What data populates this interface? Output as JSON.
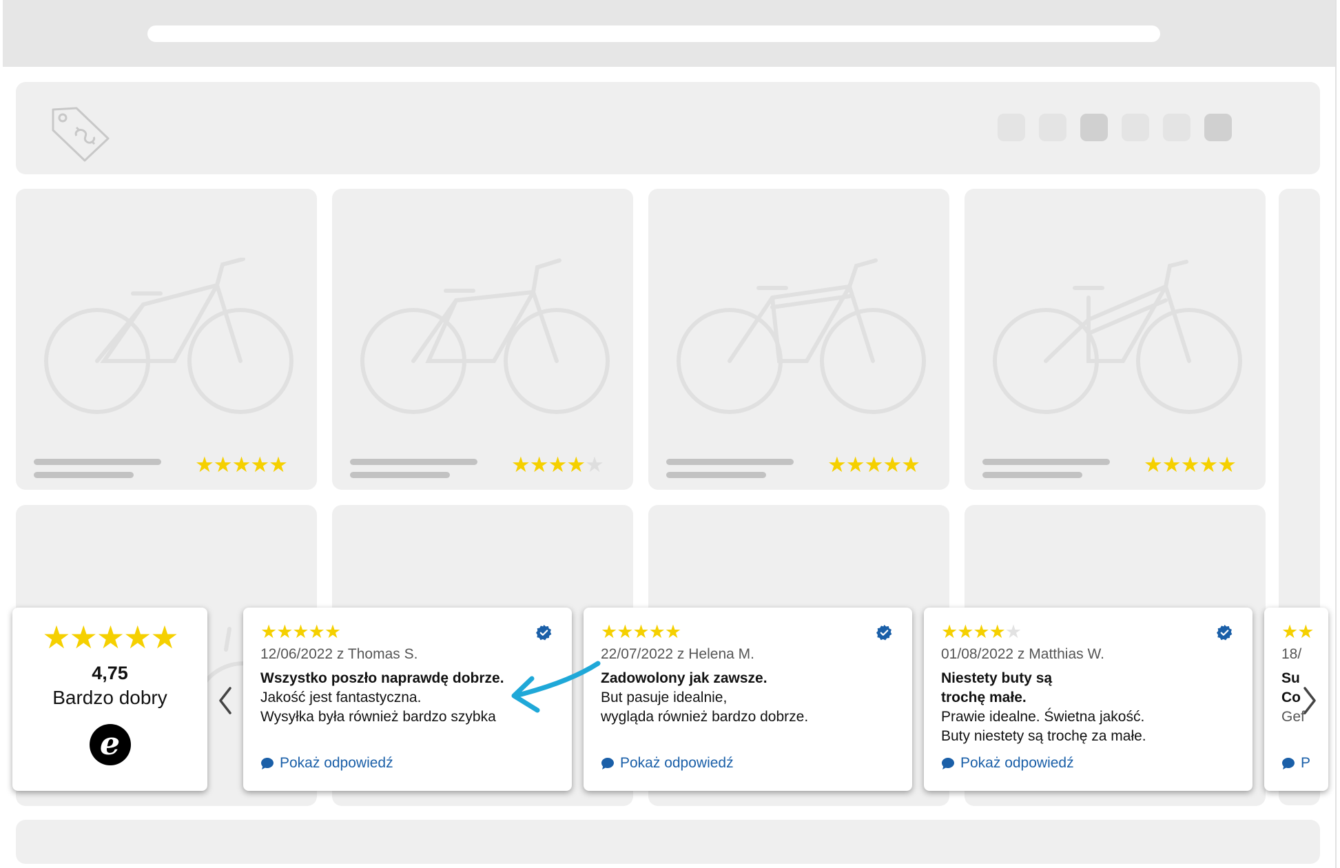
{
  "colors": {
    "star": "#f5d000",
    "link": "#1a5fa8",
    "verified": "#1a5fa8",
    "annotation": "#1fa8d8"
  },
  "icons": {
    "header": "price-tag-icon",
    "product": "bicycle-icon",
    "verified": "verified-badge-icon",
    "reply": "chat-bubble-icon",
    "prev": "chevron-left-icon",
    "next": "chevron-right-icon"
  },
  "products_row1": [
    {
      "rating": 5
    },
    {
      "rating": 4
    },
    {
      "rating": 5
    },
    {
      "rating": 5
    }
  ],
  "summary": {
    "stars": "★★★★★",
    "score": "4,75",
    "label": "Bardzo dobry",
    "logo": "e"
  },
  "reviews": [
    {
      "stars": "★★★★★",
      "meta": "12/06/2022 z Thomas S.",
      "title_lines": [
        "Wszystko poszło naprawdę dobrze."
      ],
      "body_lines": [
        "Jakość jest fantastyczna.",
        "Wysyłka była również bardzo szybka"
      ],
      "reply": "Pokaż odpowiedź"
    },
    {
      "stars": "★★★★★",
      "meta": "22/07/2022 z Helena M.",
      "title_lines": [
        "Zadowolony jak zawsze."
      ],
      "body_lines": [
        "But pasuje idealnie,",
        "wygląda również bardzo dobrze."
      ],
      "reply": "Pokaż odpowiedź"
    },
    {
      "stars_on": "★★★★",
      "stars_off": "★",
      "meta": "01/08/2022 z Matthias W.",
      "title_lines": [
        "Niestety buty są",
        "trochę małe."
      ],
      "body_lines": [
        "Prawie idealne. Świetna jakość.",
        "Buty niestety są trochę za małe."
      ],
      "reply": "Pokaż odpowiedź"
    },
    {
      "stars": "★★",
      "meta": "18/",
      "title_lines": [
        "Su",
        "Co"
      ],
      "body_lines": [
        "Gef"
      ],
      "reply": "P"
    }
  ]
}
